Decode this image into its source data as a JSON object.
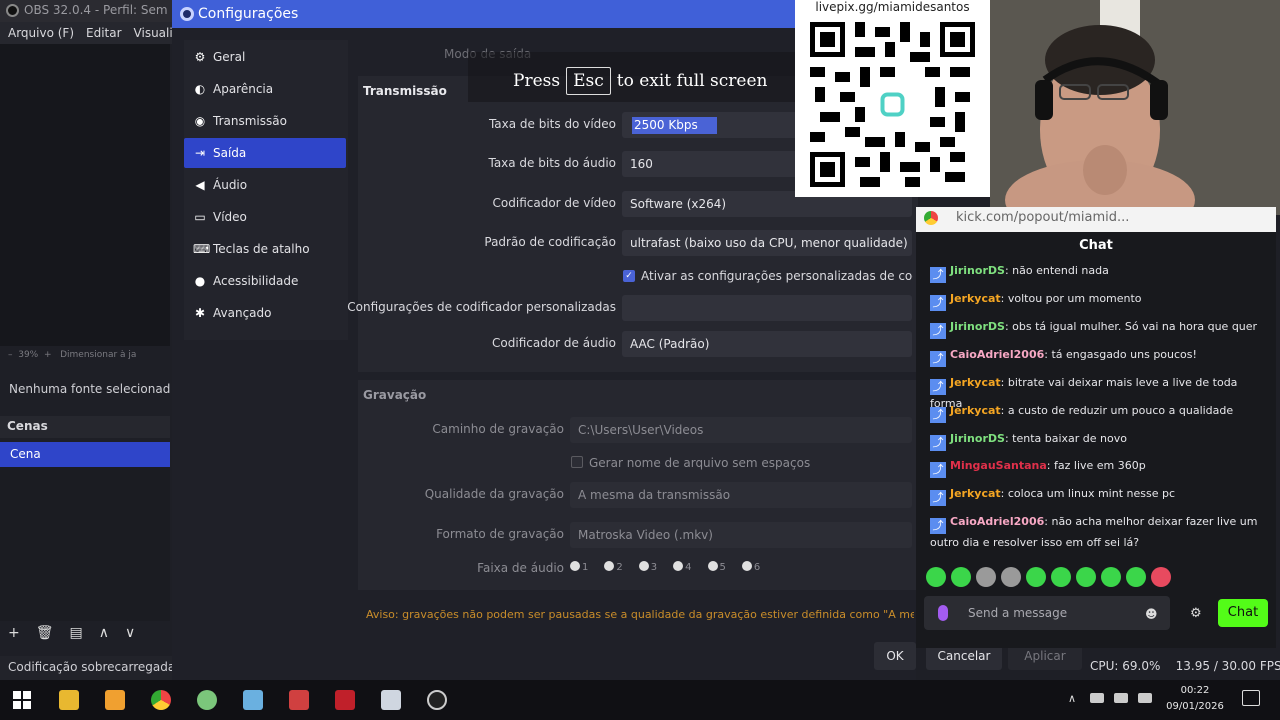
{
  "obs": {
    "title": "OBS 32.0.4 - Perfil: Sem",
    "menu": [
      "Arquivo (F)",
      "Editar",
      "Visualiz"
    ],
    "zoom_text": "39%",
    "zoom_action": "Dimensionar à ja",
    "no_source": "Nenhuma fonte selecionad",
    "scenes_header": "Cenas",
    "scene_item": "Cena",
    "status": "Codificação sobrecarregada!",
    "stats_cpu": "CPU: 69.0%",
    "stats_fps": "13.95 / 30.00 FPS"
  },
  "dialog": {
    "title": "Configurações",
    "sidebar": [
      {
        "label": "Geral",
        "icon": "gear-icon"
      },
      {
        "label": "Aparência",
        "icon": "palette-icon"
      },
      {
        "label": "Transmissão",
        "icon": "broadcast-icon"
      },
      {
        "label": "Saída",
        "icon": "output-icon"
      },
      {
        "label": "Áudio",
        "icon": "speaker-icon"
      },
      {
        "label": "Vídeo",
        "icon": "monitor-icon"
      },
      {
        "label": "Teclas de atalho",
        "icon": "keyboard-icon"
      },
      {
        "label": "Acessibilidade",
        "icon": "accessibility-icon"
      },
      {
        "label": "Avançado",
        "icon": "tools-icon"
      }
    ],
    "output_mode_label": "Modo de saída",
    "stream": {
      "title": "Transmissão",
      "video_bitrate_label": "Taxa de bits do vídeo",
      "video_bitrate_value": "2500 Kbps",
      "audio_bitrate_label": "Taxa de bits do áudio",
      "audio_bitrate_value": "160",
      "video_encoder_label": "Codificador de vídeo",
      "video_encoder_value": "Software (x264)",
      "encoder_preset_label": "Padrão de codificação",
      "encoder_preset_value": "ultrafast (baixo uso da CPU, menor qualidade)",
      "custom_settings_check": "Ativar as configurações personalizadas de codific",
      "custom_encoder_label": "Configurações de codificador personalizadas",
      "audio_encoder_label": "Codificador de áudio",
      "audio_encoder_value": "AAC (Padrão)"
    },
    "recording": {
      "title": "Gravação",
      "path_label": "Caminho de gravação",
      "path_value": "C:\\Users\\User\\Videos",
      "no_spaces_check": "Gerar nome de arquivo sem espaços",
      "quality_label": "Qualidade da gravação",
      "quality_value": "A mesma da transmissão",
      "format_label": "Formato de gravação",
      "format_value": "Matroska Video (.mkv)",
      "tracks_label": "Faixa de áudio",
      "tracks": [
        "1",
        "2",
        "3",
        "4",
        "5",
        "6"
      ]
    },
    "warning": "Aviso: gravações não podem ser pausadas se a qualidade da gravação estiver definida como \"A me",
    "buttons": {
      "ok": "OK",
      "cancel": "Cancelar",
      "apply": "Aplicar"
    }
  },
  "fullscreen_banner": {
    "press": "Press",
    "key": "Esc",
    "rest": "to exit full screen"
  },
  "qr": {
    "label": "livepix.gg/miamidesantos"
  },
  "chat": {
    "url": "kick.com/popout/miamid...",
    "title": "Chat",
    "messages": [
      {
        "user": "JirinorDS",
        "color": "#7fe07f",
        "text": "não entendi nada"
      },
      {
        "user": "Jerkycat",
        "color": "#f5a623",
        "text": "voltou por um momento"
      },
      {
        "user": "JirinorDS",
        "color": "#7fe07f",
        "text": "obs tá igual mulher. Só vai na hora que quer"
      },
      {
        "user": "CaioAdriel2006",
        "color": "#f7a8c4",
        "text": "tá engasgado uns poucos!"
      },
      {
        "user": "Jerkycat",
        "color": "#f5a623",
        "text": "bitrate vai deixar mais leve a live de toda forma"
      },
      {
        "user": "Jerkycat",
        "color": "#f5a623",
        "text": "a custo de reduzir um pouco a qualidade"
      },
      {
        "user": "JirinorDS",
        "color": "#7fe07f",
        "text": "tenta baixar de novo"
      },
      {
        "user": "MingauSantana",
        "color": "#e0304a",
        "text": "faz live em 360p"
      },
      {
        "user": "Jerkycat",
        "color": "#f5a623",
        "text": "coloca um linux mint nesse pc"
      },
      {
        "user": "CaioAdriel2006",
        "color": "#f7a8c4",
        "text": "não acha melhor deixar fazer live um outro dia e resolver isso em off sei lá?"
      }
    ],
    "input_placeholder": "Send a message",
    "send_label": "Chat"
  },
  "taskbar": {
    "time": "00:22",
    "date": "09/01/2026"
  }
}
